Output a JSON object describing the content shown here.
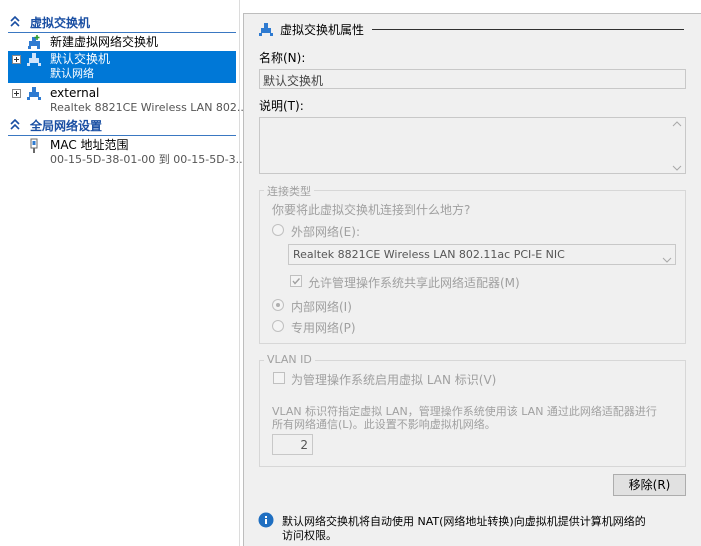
{
  "tree": {
    "virtual_switches_header": "虚拟交换机",
    "new_switch_label": "新建虚拟网络交换机",
    "default_switch": {
      "name": "默认交换机",
      "subtitle": "默认网络"
    },
    "external_switch": {
      "name": "external",
      "subtitle": "Realtek 8821CE Wireless LAN 802...."
    },
    "global_settings_header": "全局网络设置",
    "mac_range": {
      "name": "MAC 地址范围",
      "subtitle": "00-15-5D-38-01-00 到 00-15-5D-3..."
    }
  },
  "props": {
    "title": "虚拟交换机属性",
    "name_label": "名称(N):",
    "name_value": "默认交换机",
    "notes_label": "说明(T):",
    "notes_value": "",
    "conn_type": {
      "legend": "连接类型",
      "question": "你要将此虚拟交换机连接到什么地方?",
      "external_label": "外部网络(E):",
      "adapter_value": "Realtek 8821CE Wireless LAN 802.11ac PCI-E NIC",
      "allow_mgmt_label": "允许管理操作系统共享此网络适配器(M)",
      "internal_label": "内部网络(I)",
      "private_label": "专用网络(P)",
      "selected": "internal"
    },
    "vlan": {
      "legend": "VLAN ID",
      "enable_label": "为管理操作系统启用虚拟 LAN 标识(V)",
      "desc_line1": "VLAN 标识符指定虚拟 LAN，管理操作系统使用该 LAN 通过此网络适配器进行",
      "desc_line2": "所有网络通信(L)。此设置不影响虚拟机网络。",
      "value": "2"
    },
    "remove_button": "移除(R)",
    "info_line1": "默认网络交换机将自动使用 NAT(网络地址转换)向虚拟机提供计算机网络的",
    "info_line2": "访问权限。"
  },
  "colors": {
    "accent": "#1a4fa3",
    "selection": "#0078d7",
    "info": "#1f6fc1"
  }
}
